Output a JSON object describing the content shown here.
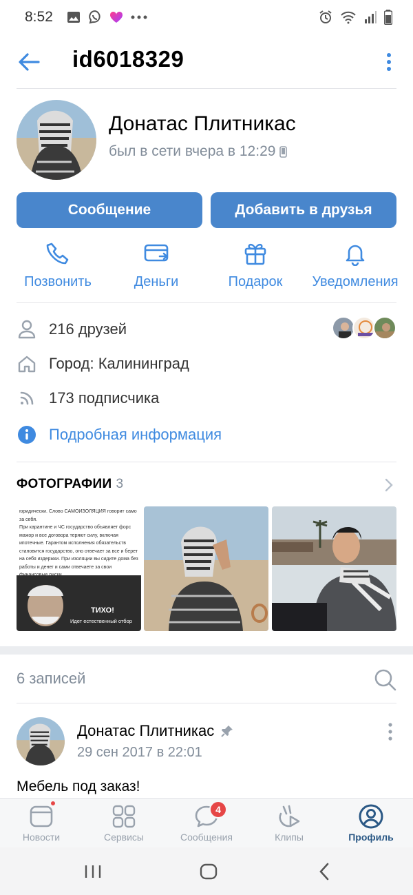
{
  "status_bar": {
    "time": "8:52",
    "left_icons": [
      "gallery-icon",
      "viber-icon",
      "heart-icon",
      "more-dots"
    ],
    "right_icons": [
      "alarm-icon",
      "wifi-icon",
      "signal-icon",
      "battery-icon"
    ]
  },
  "header": {
    "title": "id6018329"
  },
  "profile": {
    "name": "Донатас Плитникас",
    "status": "был в сети вчера в 12:29"
  },
  "buttons": {
    "message": "Сообщение",
    "add_friend": "Добавить в друзья"
  },
  "actions": [
    {
      "label": "Позвонить",
      "icon": "phone-icon"
    },
    {
      "label": "Деньги",
      "icon": "money-icon"
    },
    {
      "label": "Подарок",
      "icon": "gift-icon"
    },
    {
      "label": "Уведомления",
      "icon": "bell-icon"
    }
  ],
  "info": {
    "friends": "216 друзей",
    "city": "Город: Калининград",
    "followers": "173 подписчика",
    "details": "Подробная информация"
  },
  "photos": {
    "title": "ФОТОГРАФИИ",
    "count": "3",
    "first_text": "юридически. Слово САМОИЗОЛЯЦИЯ говорит само за себя.\nПри карантине и ЧС государство объявляет форс мажор и все договора теряют силу, включая ипотечные. Гарантом исполнения обязательств становится государство, оно отвечает за все и берет на себя издержки. При изоляции вы сидите дома без работы и денег и сами отвечаете за свои финансовые риски.\nВот и вся арифметика.",
    "first_caption": "ТИХО!",
    "first_subcaption": "Идет естественный отбор"
  },
  "posts": {
    "count_label": "6 записей"
  },
  "post": {
    "author": "Донатас Плитникас",
    "date": "29 сен 2017 в 22:01",
    "text": "Мебель под заказ!"
  },
  "tabs": [
    {
      "label": "Новости"
    },
    {
      "label": "Сервисы"
    },
    {
      "label": "Сообщения",
      "badge": "4"
    },
    {
      "label": "Клипы"
    },
    {
      "label": "Профиль"
    }
  ],
  "colors": {
    "accent": "#3f8ae0",
    "button": "#4986cc",
    "secondary_text": "#818c99",
    "badge": "#e64646"
  }
}
